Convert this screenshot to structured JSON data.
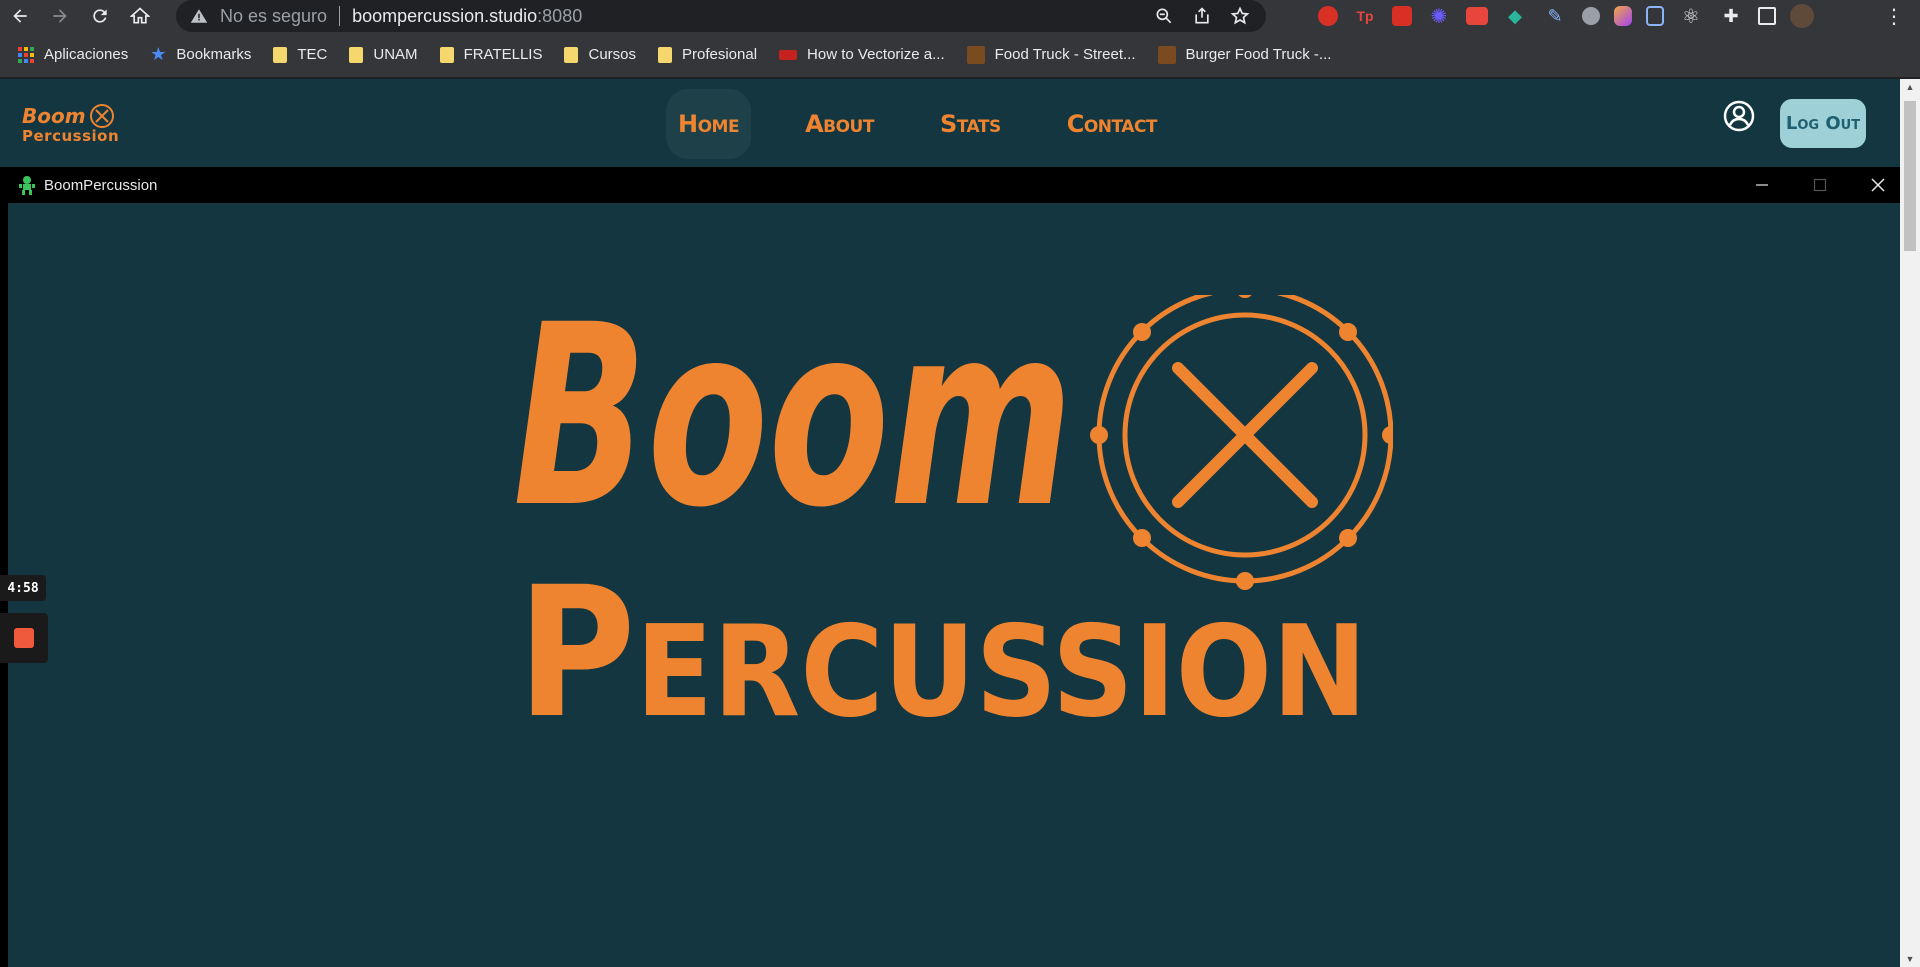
{
  "browser": {
    "security_label": "No es seguro",
    "url_host": "boompercussion.studio",
    "url_port": ":8080",
    "bookmarks": [
      {
        "label": "Aplicaciones",
        "icon": "apps-grid-icon"
      },
      {
        "label": "Bookmarks",
        "icon": "star-icon"
      },
      {
        "label": "TEC",
        "icon": "folder-icon"
      },
      {
        "label": "UNAM",
        "icon": "folder-icon"
      },
      {
        "label": "FRATELLIS",
        "icon": "folder-icon"
      },
      {
        "label": "Cursos",
        "icon": "folder-icon"
      },
      {
        "label": "Profesional",
        "icon": "folder-icon"
      },
      {
        "label": "How to Vectorize a...",
        "icon": "site-favicon"
      },
      {
        "label": "Food Truck - Street...",
        "icon": "site-favicon"
      },
      {
        "label": "Burger Food Truck -...",
        "icon": "site-favicon"
      }
    ],
    "extension_colors": [
      "#d93025",
      "#e8453c",
      "#d93025",
      "#6b5cff",
      "#e8453c",
      "#2bb5a0",
      "#8ab4f8",
      "#9aa0a6",
      "#f4a742",
      "#8ab4f8",
      "#8ab4f8",
      "#e8eaed"
    ]
  },
  "site": {
    "logo_line1": "Boom",
    "logo_line2": "Percussion",
    "nav": [
      {
        "label": "Home",
        "active": true
      },
      {
        "label": "About",
        "active": false
      },
      {
        "label": "Stats",
        "active": false
      },
      {
        "label": "Contact",
        "active": false
      }
    ],
    "logout_label": "Log Out",
    "colors": {
      "background": "#133640",
      "accent": "#ef8430",
      "button": "#9ed0d8"
    }
  },
  "app_window": {
    "title": "BoomPercussion",
    "hero_line1": "Boom",
    "hero_line2": "Percussion"
  },
  "recorder": {
    "timer": "4:58"
  }
}
